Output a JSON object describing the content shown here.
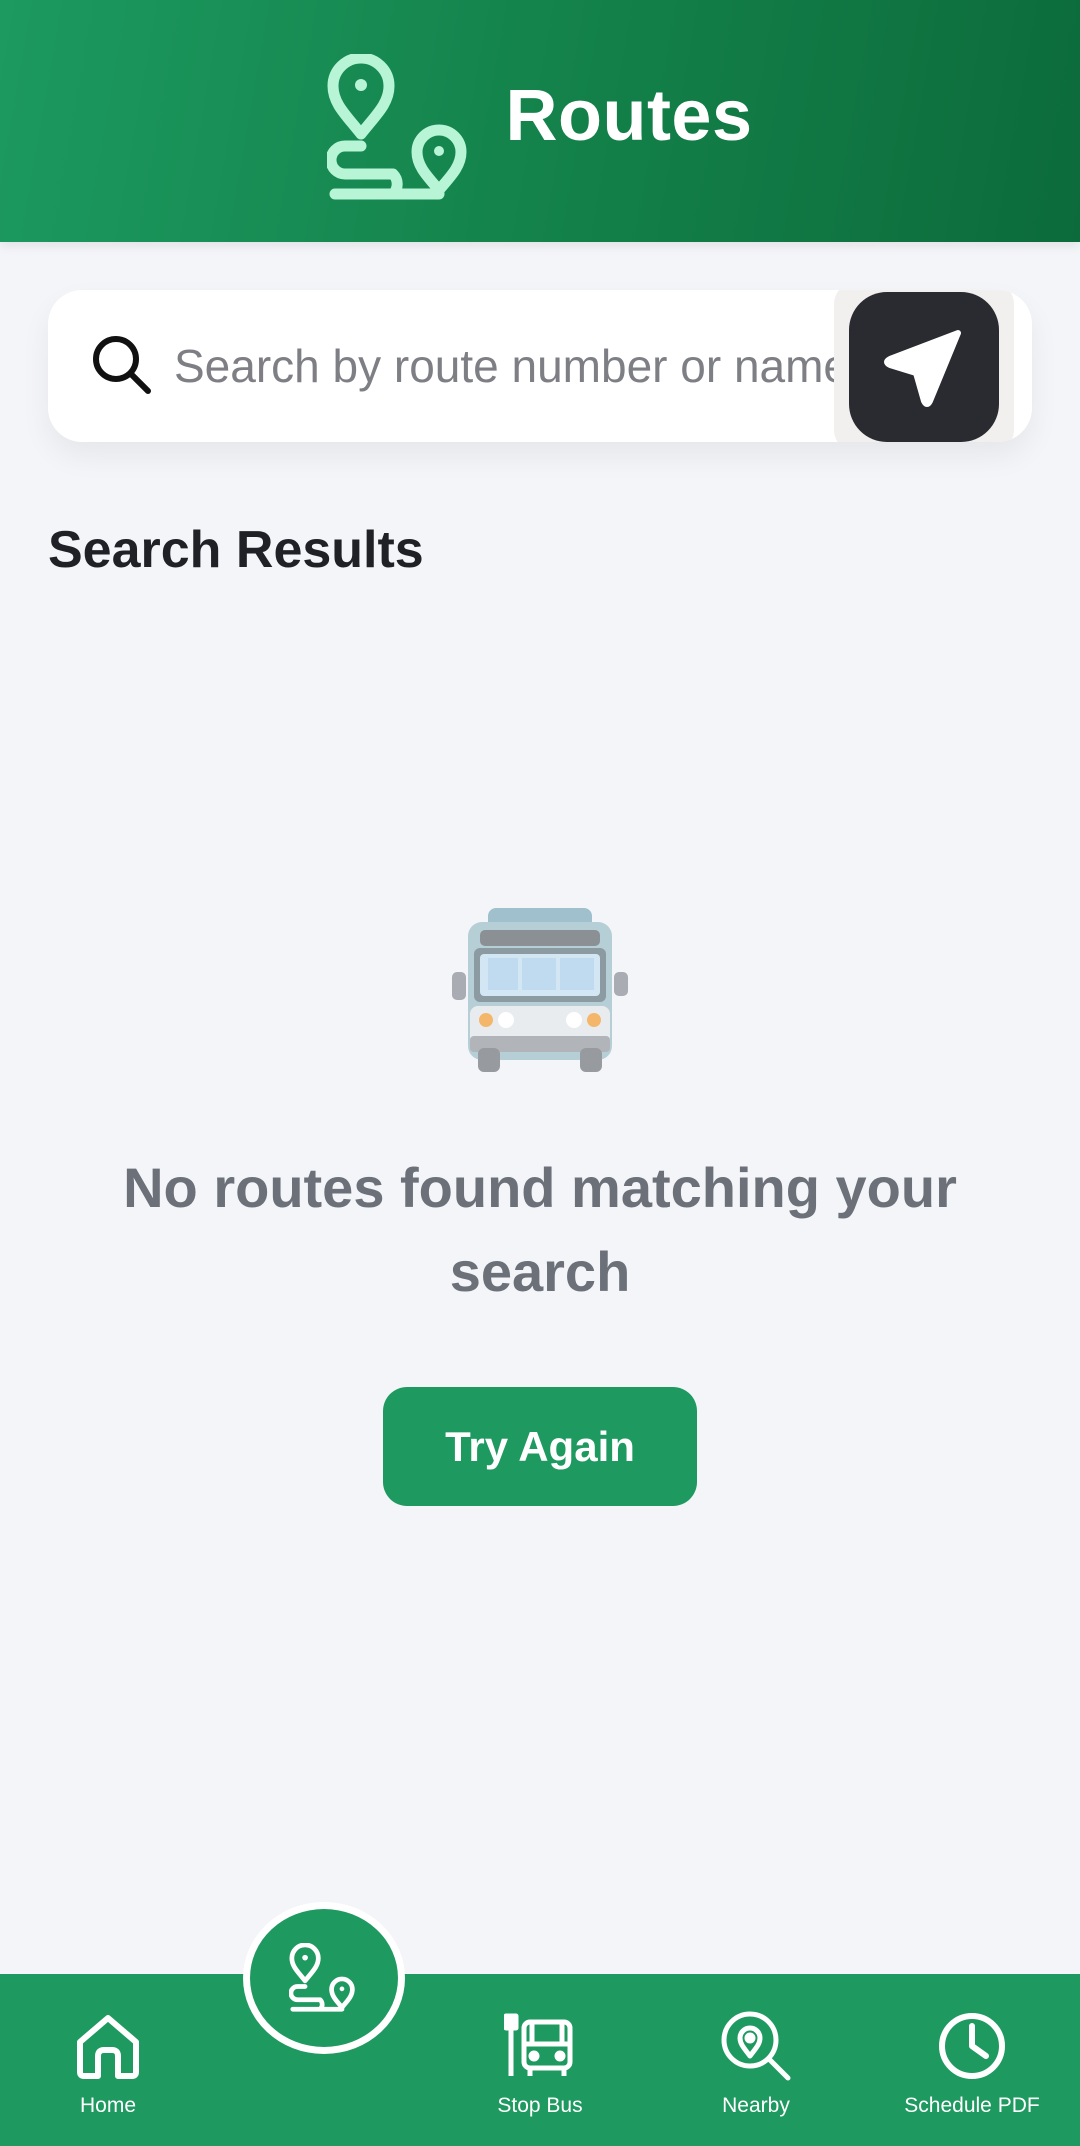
{
  "header": {
    "title": "Routes",
    "icon": "route-pins-icon"
  },
  "search": {
    "placeholder": "Search by route number or name",
    "value": "",
    "icon": "search-icon",
    "locate_icon": "navigation-arrow-icon"
  },
  "results": {
    "section_title": "Search Results",
    "empty_icon": "bus-icon",
    "empty_message": "No routes found matching your search",
    "retry_label": "Try Again"
  },
  "nav": {
    "active": "routes",
    "items": [
      {
        "key": "home",
        "label": "Home",
        "icon": "home-icon"
      },
      {
        "key": "routes",
        "label": "",
        "icon": "route-pins-icon"
      },
      {
        "key": "stop_bus",
        "label": "Stop Bus",
        "icon": "bus-stop-icon"
      },
      {
        "key": "nearby",
        "label": "Nearby",
        "icon": "nearby-search-icon"
      },
      {
        "key": "schedule_pdf",
        "label": "Schedule PDF",
        "icon": "clock-icon"
      }
    ]
  },
  "colors": {
    "primary": "#1e9a60",
    "header_dark": "#0c6b3b",
    "icon_mint": "#b8f5d6",
    "background": "#f4f5f9",
    "muted_text": "#6b7079"
  }
}
